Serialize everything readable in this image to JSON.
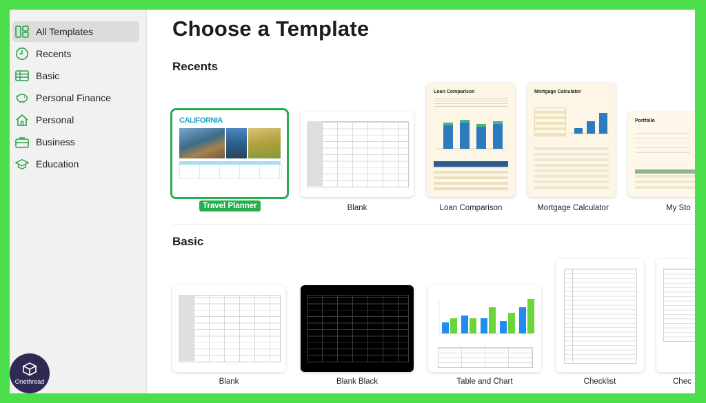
{
  "sidebar": {
    "items": [
      {
        "label": "All Templates",
        "icon": "grid-icon",
        "active": true
      },
      {
        "label": "Recents",
        "icon": "clock-icon"
      },
      {
        "label": "Basic",
        "icon": "table-icon"
      },
      {
        "label": "Personal Finance",
        "icon": "piggy-bank-icon"
      },
      {
        "label": "Personal",
        "icon": "house-icon"
      },
      {
        "label": "Business",
        "icon": "briefcase-icon"
      },
      {
        "label": "Education",
        "icon": "graduation-cap-icon"
      }
    ]
  },
  "main": {
    "title": "Choose a Template",
    "recents": {
      "heading": "Recents",
      "templates": [
        {
          "label": "Travel Planner",
          "selected": true,
          "thumb_heading": "CALIFORNIA"
        },
        {
          "label": "Blank"
        },
        {
          "label": "Loan Comparison",
          "thumb_heading": "Loan Comparison"
        },
        {
          "label": "Mortgage Calculator",
          "thumb_heading": "Mortgage Calculator"
        },
        {
          "label": "My Sto",
          "thumb_heading": "Portfolio"
        }
      ]
    },
    "basic": {
      "heading": "Basic",
      "templates": [
        {
          "label": "Blank"
        },
        {
          "label": "Blank Black"
        },
        {
          "label": "Table and Chart"
        },
        {
          "label": "Checklist"
        },
        {
          "label": "Chec"
        }
      ]
    }
  },
  "brand": {
    "logo_text": "Onethread"
  },
  "colors": {
    "accent": "#27ae4f",
    "frame": "#4be04b",
    "chart_blue": "#1f8ef0",
    "chart_green": "#6ad63b"
  }
}
